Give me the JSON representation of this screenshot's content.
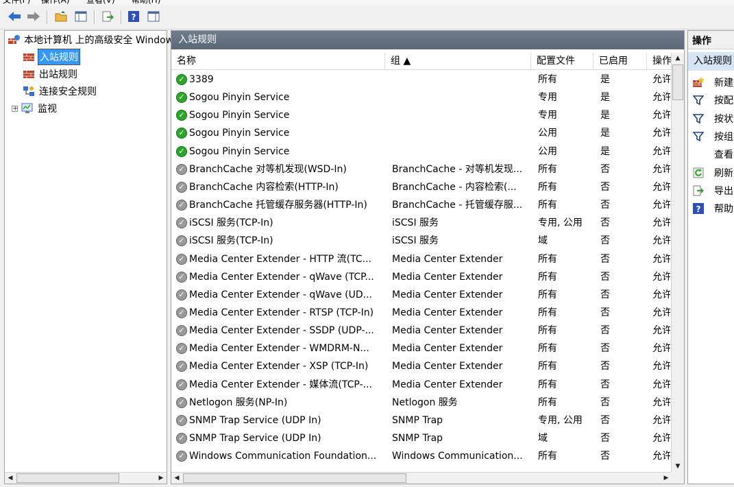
{
  "menubar": [
    "文件(F)",
    "操作(A)",
    "查看(V)",
    "帮助(H)"
  ],
  "toolbar": {
    "buttons": [
      "back-icon",
      "forward-icon",
      "up-folder-icon",
      "show-hide-tree-icon",
      "export-icon",
      "help-icon",
      "show-hide-action-icon"
    ]
  },
  "tree": {
    "root": "本地计算机 上的高级安全 Windows 防火墙",
    "items": [
      {
        "label": "入站规则",
        "selected": true
      },
      {
        "label": "出站规则"
      },
      {
        "label": "连接安全规则"
      },
      {
        "label": "监视",
        "expander": "+"
      }
    ]
  },
  "center": {
    "title": "入站规则",
    "columns": [
      {
        "label": "名称"
      },
      {
        "label": "组 ▲"
      },
      {
        "label": "配置文件"
      },
      {
        "label": "已启用"
      },
      {
        "label": "操作"
      }
    ],
    "rows": [
      {
        "name": "3389",
        "group": "",
        "profile": "所有",
        "enabled": "是",
        "action": "允许",
        "on": true
      },
      {
        "name": "Sogou Pinyin Service",
        "group": "",
        "profile": "专用",
        "enabled": "是",
        "action": "允许",
        "on": true
      },
      {
        "name": "Sogou Pinyin Service",
        "group": "",
        "profile": "专用",
        "enabled": "是",
        "action": "允许",
        "on": true
      },
      {
        "name": "Sogou Pinyin Service",
        "group": "",
        "profile": "公用",
        "enabled": "是",
        "action": "允许",
        "on": true
      },
      {
        "name": "Sogou Pinyin Service",
        "group": "",
        "profile": "公用",
        "enabled": "是",
        "action": "允许",
        "on": true
      },
      {
        "name": "BranchCache 对等机发现(WSD-In)",
        "group": "BranchCache - 对等机发现...",
        "profile": "所有",
        "enabled": "否",
        "action": "允许",
        "on": false
      },
      {
        "name": "BranchCache 内容检索(HTTP-In)",
        "group": "BranchCache - 内容检索(...",
        "profile": "所有",
        "enabled": "否",
        "action": "允许",
        "on": false
      },
      {
        "name": "BranchCache 托管缓存服务器(HTTP-In)",
        "group": "BranchCache - 托管缓存服...",
        "profile": "所有",
        "enabled": "否",
        "action": "允许",
        "on": false
      },
      {
        "name": "iSCSI 服务(TCP-In)",
        "group": "iSCSI 服务",
        "profile": "专用, 公用",
        "enabled": "否",
        "action": "允许",
        "on": false
      },
      {
        "name": "iSCSI 服务(TCP-In)",
        "group": "iSCSI 服务",
        "profile": "域",
        "enabled": "否",
        "action": "允许",
        "on": false
      },
      {
        "name": "Media Center Extender - HTTP 流(TC...",
        "group": "Media Center Extender",
        "profile": "所有",
        "enabled": "否",
        "action": "允许",
        "on": false
      },
      {
        "name": "Media Center Extender - qWave (TCP...",
        "group": "Media Center Extender",
        "profile": "所有",
        "enabled": "否",
        "action": "允许",
        "on": false
      },
      {
        "name": "Media Center Extender - qWave (UD...",
        "group": "Media Center Extender",
        "profile": "所有",
        "enabled": "否",
        "action": "允许",
        "on": false
      },
      {
        "name": "Media Center Extender - RTSP (TCP-In)",
        "group": "Media Center Extender",
        "profile": "所有",
        "enabled": "否",
        "action": "允许",
        "on": false
      },
      {
        "name": "Media Center Extender - SSDP (UDP-...",
        "group": "Media Center Extender",
        "profile": "所有",
        "enabled": "否",
        "action": "允许",
        "on": false
      },
      {
        "name": "Media Center Extender - WMDRM-N...",
        "group": "Media Center Extender",
        "profile": "所有",
        "enabled": "否",
        "action": "允许",
        "on": false
      },
      {
        "name": "Media Center Extender - XSP (TCP-In)",
        "group": "Media Center Extender",
        "profile": "所有",
        "enabled": "否",
        "action": "允许",
        "on": false
      },
      {
        "name": "Media Center Extender - 媒体流(TCP-...",
        "group": "Media Center Extender",
        "profile": "所有",
        "enabled": "否",
        "action": "允许",
        "on": false
      },
      {
        "name": "Netlogon 服务(NP-In)",
        "group": "Netlogon 服务",
        "profile": "所有",
        "enabled": "否",
        "action": "允许",
        "on": false
      },
      {
        "name": "SNMP Trap Service (UDP In)",
        "group": "SNMP Trap",
        "profile": "专用, 公用",
        "enabled": "否",
        "action": "允许",
        "on": false
      },
      {
        "name": "SNMP Trap Service (UDP In)",
        "group": "SNMP Trap",
        "profile": "域",
        "enabled": "否",
        "action": "允许",
        "on": false
      },
      {
        "name": "Windows Communication Foundation...",
        "group": "Windows Communication...",
        "profile": "所有",
        "enabled": "否",
        "action": "允许",
        "on": false
      }
    ]
  },
  "actions": {
    "title": "操作",
    "section": "入站规则",
    "items": [
      {
        "label": "新建规则...",
        "icon": "new-rule-icon"
      },
      {
        "label": "按配置文件筛选",
        "icon": "filter-icon"
      },
      {
        "label": "按状态筛选",
        "icon": "filter-icon"
      },
      {
        "label": "按组筛选",
        "icon": "filter-icon"
      },
      {
        "label": "查看",
        "icon": ""
      },
      {
        "label": "刷新",
        "icon": "refresh-icon"
      },
      {
        "label": "导出列表...",
        "icon": "export-icon"
      },
      {
        "label": "帮助",
        "icon": "help-icon"
      }
    ]
  },
  "colors": {
    "selection": "#3399ff",
    "pane_title": "#5b6877",
    "enabled_icon": "#2da52d",
    "disabled_icon": "#9a9a9a",
    "action_section": "#d6e4f3"
  }
}
